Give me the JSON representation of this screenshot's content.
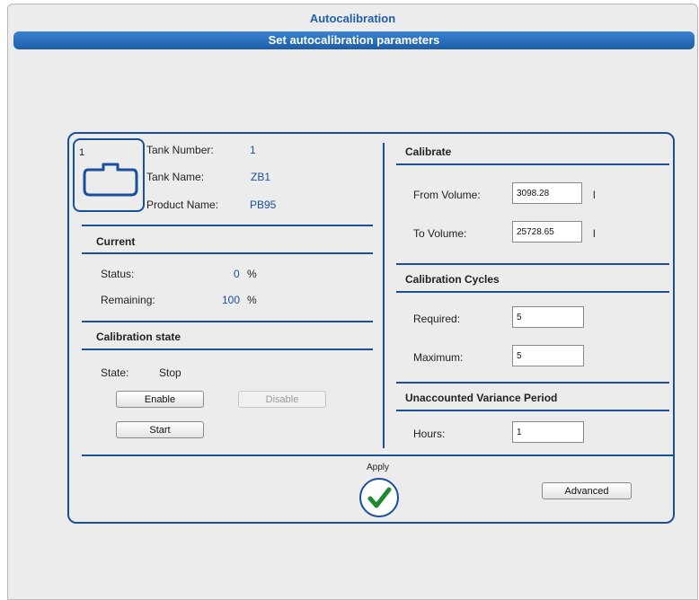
{
  "window": {
    "title": "Autocalibration",
    "subtitle": "Set autocalibration parameters"
  },
  "tank": {
    "badge_number": "1",
    "tank_number_label": "Tank Number:",
    "tank_number": "1",
    "tank_name_label": "Tank Name:",
    "tank_name": "ZB1",
    "product_name_label": "Product Name:",
    "product_name": "PB95"
  },
  "current": {
    "header": "Current",
    "status_label": "Status:",
    "status_value": "0",
    "status_unit": "%",
    "remaining_label": "Remaining:",
    "remaining_value": "100",
    "remaining_unit": "%"
  },
  "calibration_state": {
    "header": "Calibration state",
    "state_label": "State:",
    "state_value": "Stop",
    "enable_label": "Enable",
    "disable_label": "Disable",
    "start_label": "Start"
  },
  "calibrate": {
    "header": "Calibrate",
    "from_label": "From Volume:",
    "from_value": "3098.28",
    "from_unit": "l",
    "to_label": "To Volume:",
    "to_value": "25728.65",
    "to_unit": "l"
  },
  "cycles": {
    "header": "Calibration Cycles",
    "required_label": "Required:",
    "required_value": "5",
    "maximum_label": "Maximum:",
    "maximum_value": "5"
  },
  "variance": {
    "header": "Unaccounted Variance Period",
    "hours_label": "Hours:",
    "hours_value": "1"
  },
  "footer": {
    "apply_label": "Apply",
    "advanced_label": "Advanced"
  },
  "icons": {
    "tank": "tank-icon",
    "apply": "checkmark-icon"
  },
  "colors": {
    "accent": "#1a4f9c",
    "title_bar": "#1d5da8",
    "apply_check": "#1f8a2e"
  }
}
